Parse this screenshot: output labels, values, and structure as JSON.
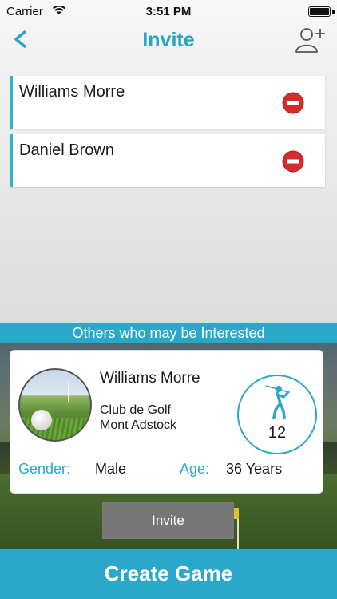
{
  "status_bar": {
    "carrier": "Carrier",
    "time": "3:51 PM"
  },
  "nav": {
    "title": "Invite",
    "back_icon": "chevron-left-icon",
    "add_user_icon": "add-user-icon"
  },
  "invitees": [
    {
      "name": "Williams Morre"
    },
    {
      "name": "Daniel Brown"
    }
  ],
  "suggestions": {
    "header": "Others who may be Interested",
    "profile": {
      "name": "Williams Morre",
      "club_line1": "Club de Golf",
      "club_line2": "Mont Adstock",
      "handicap": "12",
      "gender_label": "Gender:",
      "gender_value": "Male",
      "age_label": "Age:",
      "age_value": "36 Years"
    },
    "invite_button": "Invite"
  },
  "footer": {
    "create_game": "Create Game"
  },
  "colors": {
    "accent": "#2aa7c9",
    "remove": "#d22c2c",
    "invite_button": "#777777"
  }
}
